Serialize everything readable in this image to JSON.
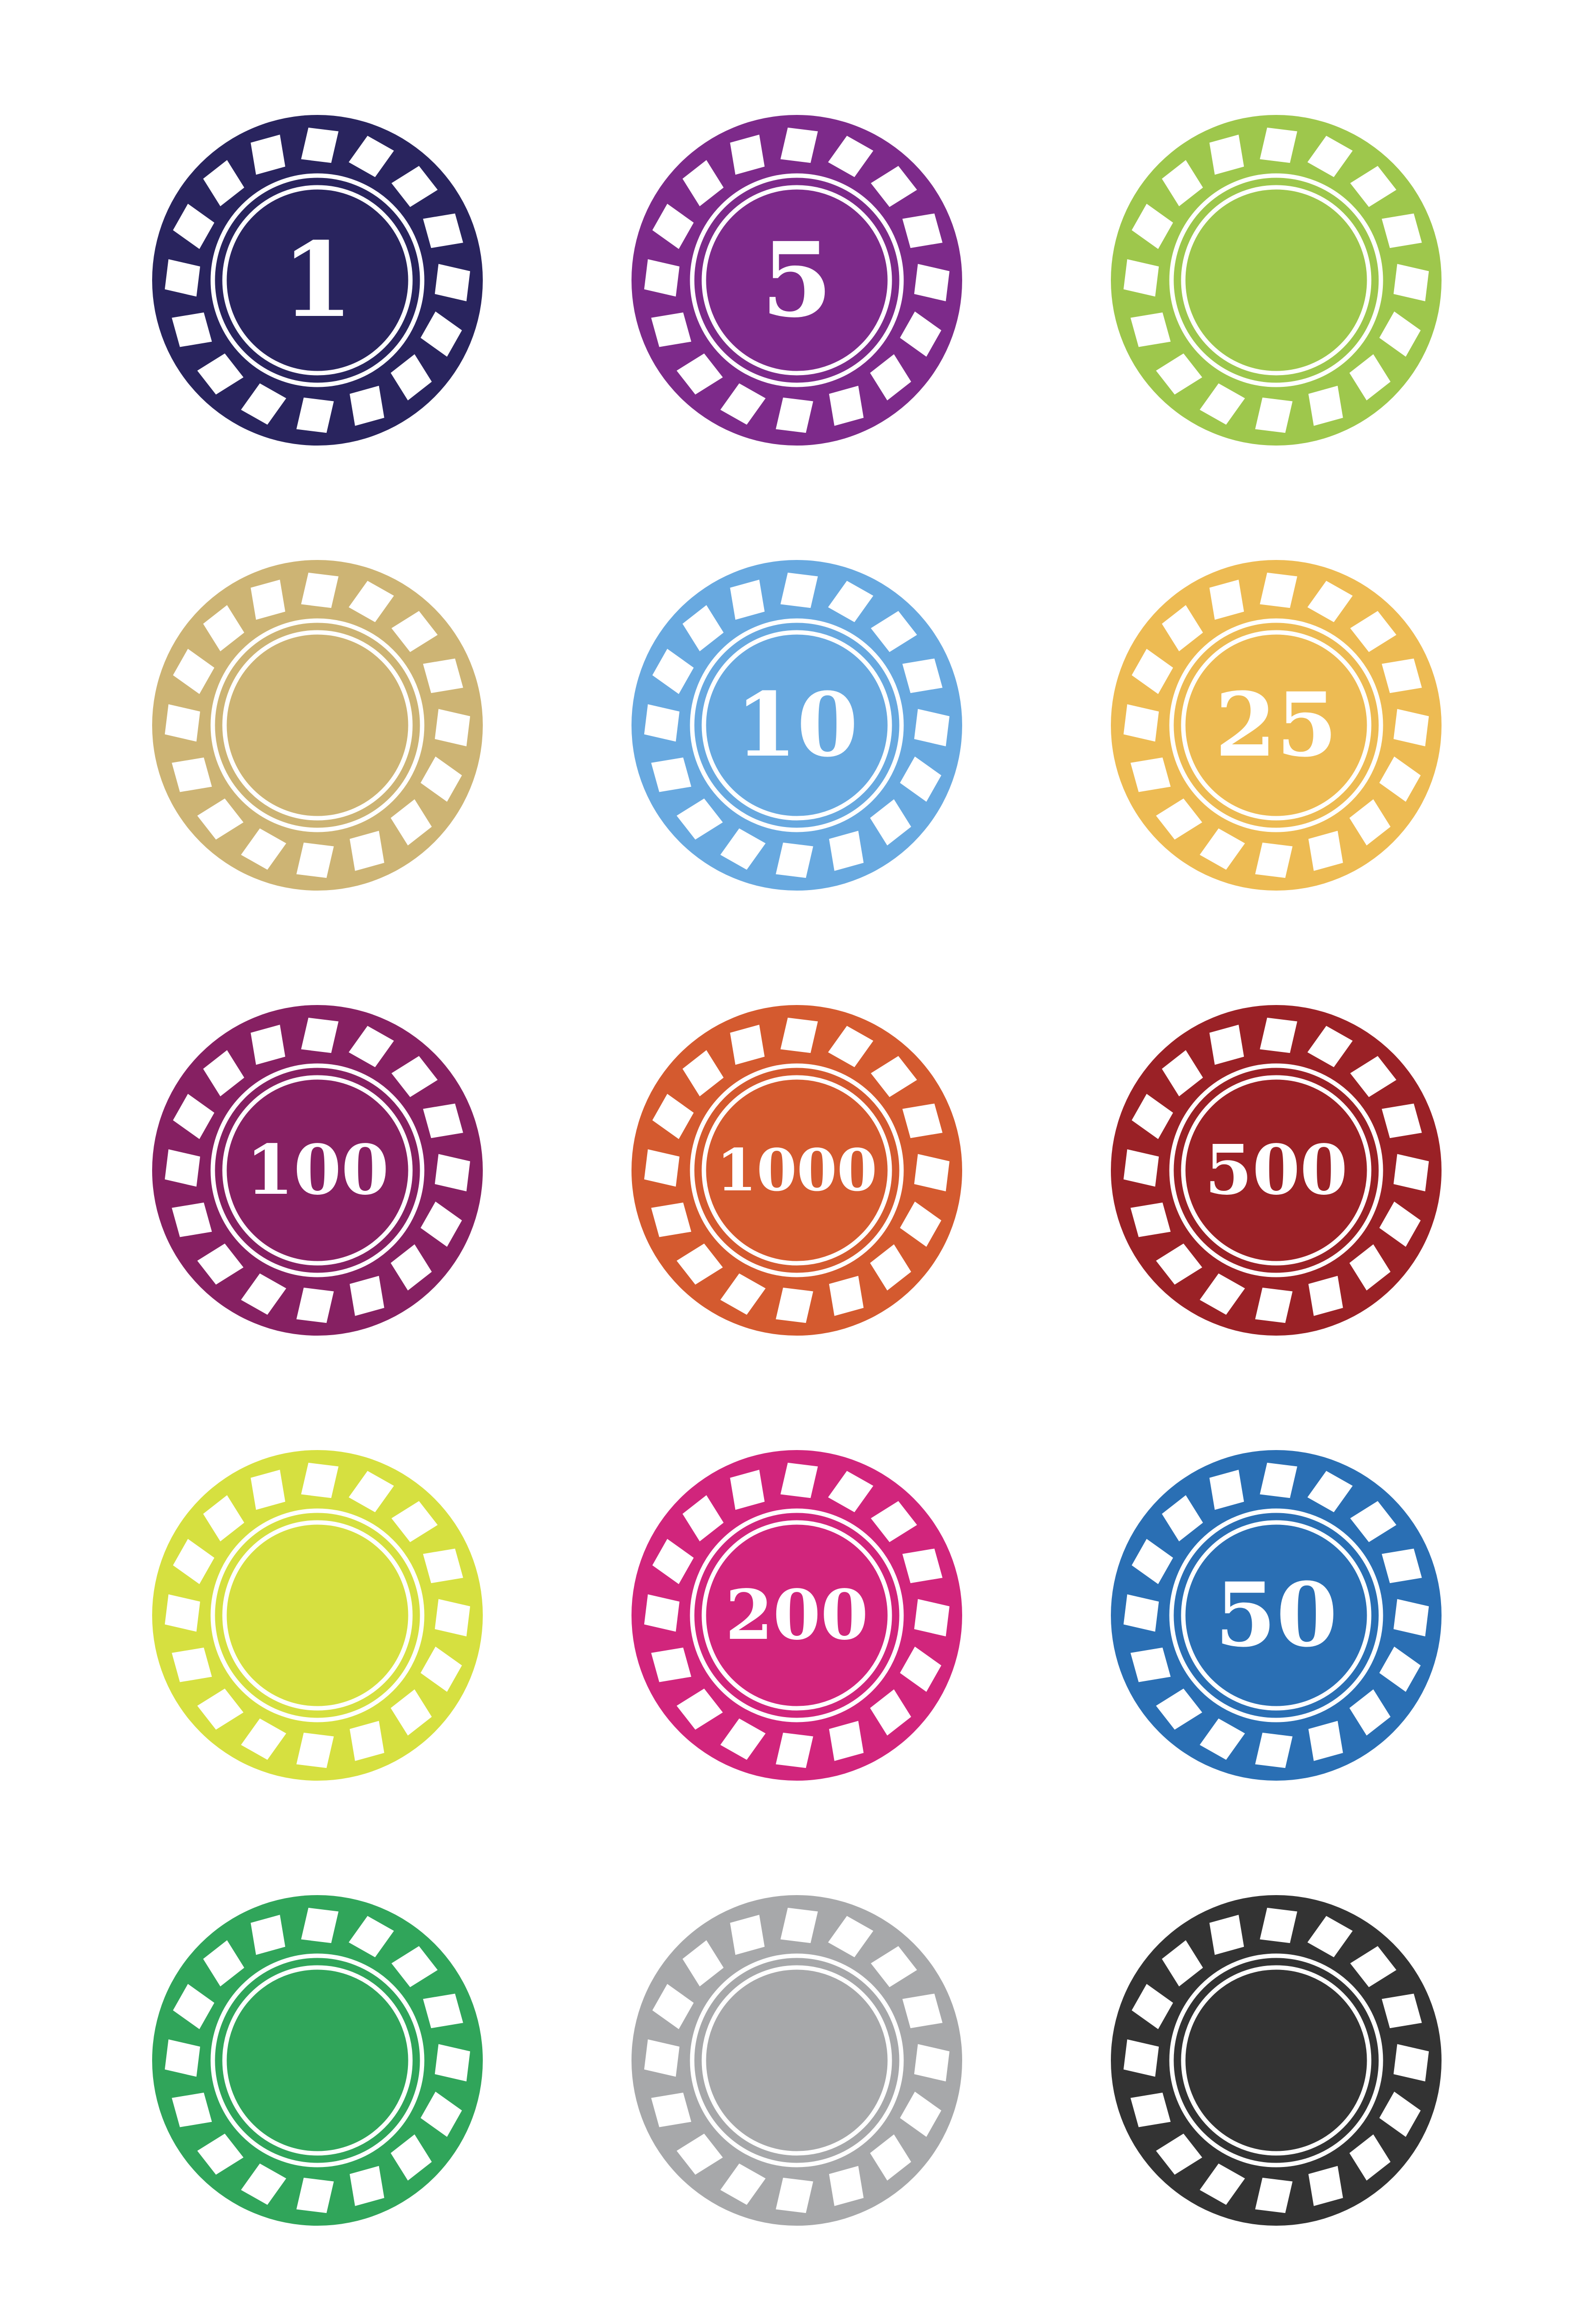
{
  "chips": [
    {
      "color": "#29245e",
      "value": "1"
    },
    {
      "color": "#7d2a8a",
      "value": "5"
    },
    {
      "color": "#9ec74c",
      "value": ""
    },
    {
      "color": "#cdb474",
      "value": ""
    },
    {
      "color": "#68a9e0",
      "value": "10"
    },
    {
      "color": "#edbb53",
      "value": "25"
    },
    {
      "color": "#862062",
      "value": "100"
    },
    {
      "color": "#d45a2f",
      "value": "1000"
    },
    {
      "color": "#9a2126",
      "value": "500"
    },
    {
      "color": "#d6e040",
      "value": ""
    },
    {
      "color": "#d1257c",
      "value": "200"
    },
    {
      "color": "#2a6fb4",
      "value": "50"
    },
    {
      "color": "#30a55a",
      "value": ""
    },
    {
      "color": "#a7a8aa",
      "value": ""
    },
    {
      "color": "#333333",
      "value": ""
    }
  ]
}
